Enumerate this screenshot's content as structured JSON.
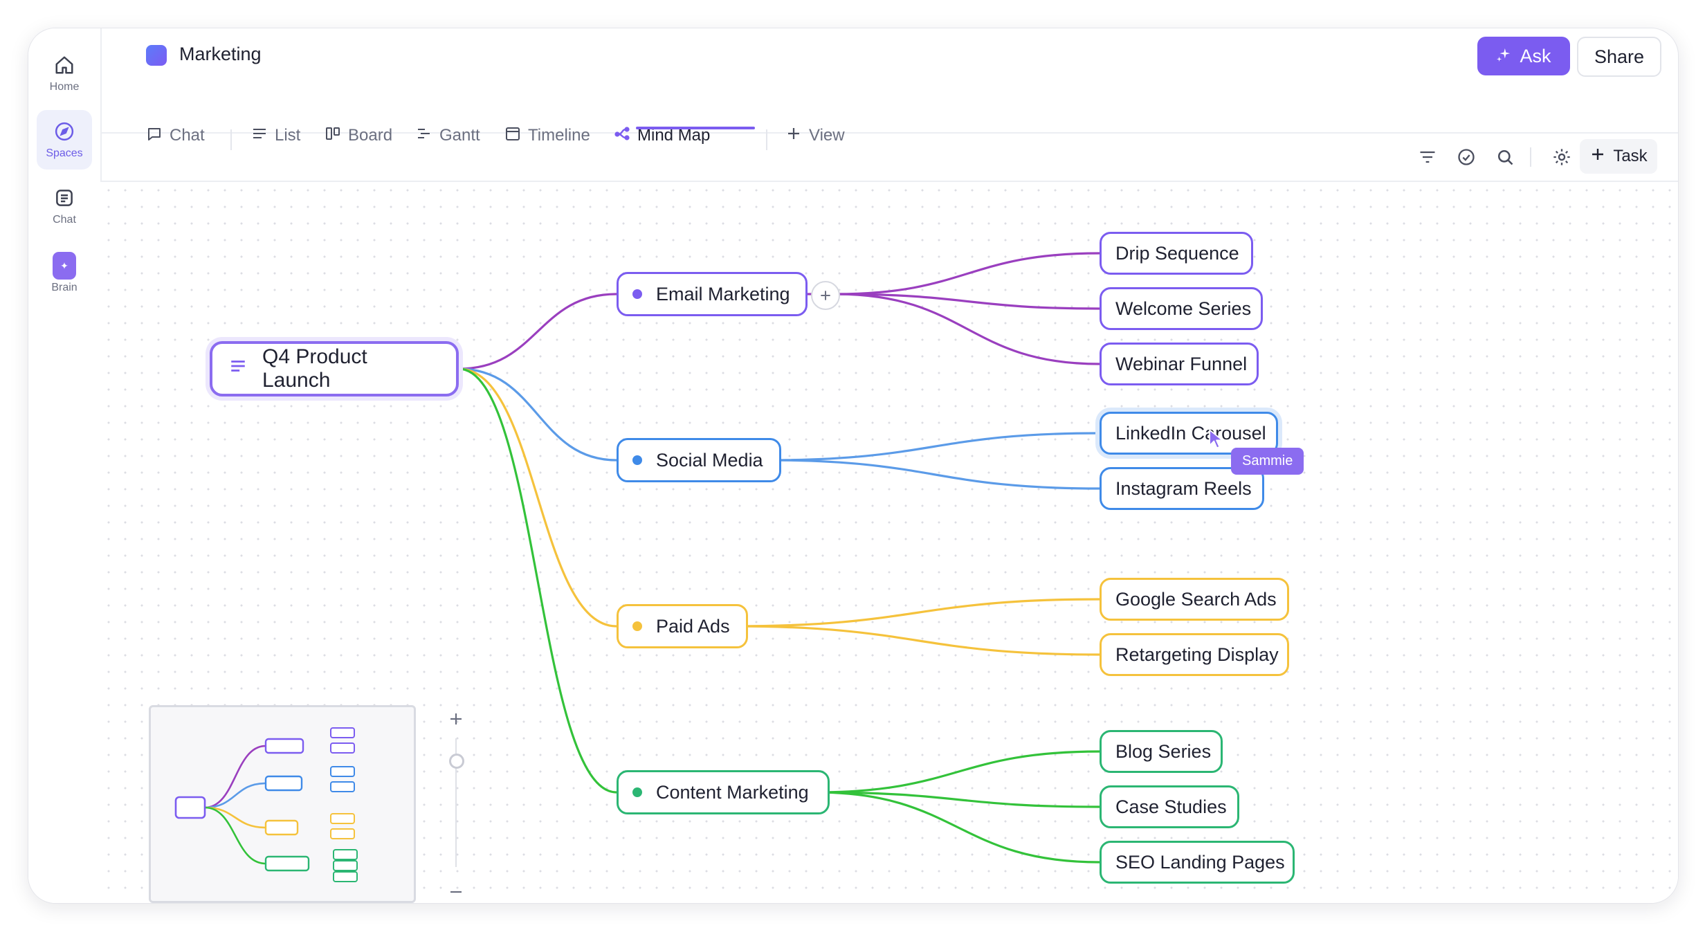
{
  "rail": {
    "items": [
      {
        "label": "Home",
        "icon": "home-icon",
        "active": false
      },
      {
        "label": "Spaces",
        "icon": "compass-icon",
        "active": true
      },
      {
        "label": "Chat",
        "icon": "chat-icon",
        "active": false
      },
      {
        "label": "Brain",
        "icon": "brain-icon",
        "active": false
      }
    ]
  },
  "header": {
    "space_title": "Marketing",
    "ask_label": "Ask",
    "share_label": "Share",
    "tabs": [
      {
        "label": "Chat",
        "icon": "chat-bubble-icon",
        "active": false
      },
      {
        "label": "List",
        "icon": "list-icon",
        "active": false
      },
      {
        "label": "Board",
        "icon": "board-icon",
        "active": false
      },
      {
        "label": "Gantt",
        "icon": "gantt-icon",
        "active": false
      },
      {
        "label": "Timeline",
        "icon": "calendar-icon",
        "active": false
      },
      {
        "label": "Mind Map",
        "icon": "mindmap-icon",
        "active": true
      },
      {
        "label": "View",
        "icon": "plus-icon",
        "active": false
      }
    ]
  },
  "toolbar": {
    "task_label": "Task",
    "icons": [
      "filter-icon",
      "check-circle-icon",
      "search-icon",
      "settings-icon"
    ]
  },
  "colors": {
    "accent": "#7b5cf0",
    "email": "#9a3fbf",
    "email_border": "#7b5cf0",
    "social": "#5b9be8",
    "social_border": "#3f8ae8",
    "paid": "#f5c23c",
    "content": "#33c23a",
    "content_border": "#2bb673"
  },
  "mindmap": {
    "root": {
      "label": "Q4 Product Launch",
      "icon": "lines-icon"
    },
    "branches": [
      {
        "label": "Email Marketing",
        "color_key": "email",
        "children": [
          "Drip Sequence",
          "Welcome Series",
          "Webinar Funnel"
        ]
      },
      {
        "label": "Social Media",
        "color_key": "social",
        "children": [
          "LinkedIn Carousel",
          "Instagram Reels"
        ]
      },
      {
        "label": "Paid Ads",
        "color_key": "paid",
        "children": [
          "Google Search Ads",
          "Retargeting Display"
        ]
      },
      {
        "label": "Content Marketing",
        "color_key": "content",
        "children": [
          "Blog Series",
          "Case Studies",
          "SEO Landing Pages"
        ]
      }
    ]
  },
  "collaborator": {
    "name": "Sammie"
  }
}
